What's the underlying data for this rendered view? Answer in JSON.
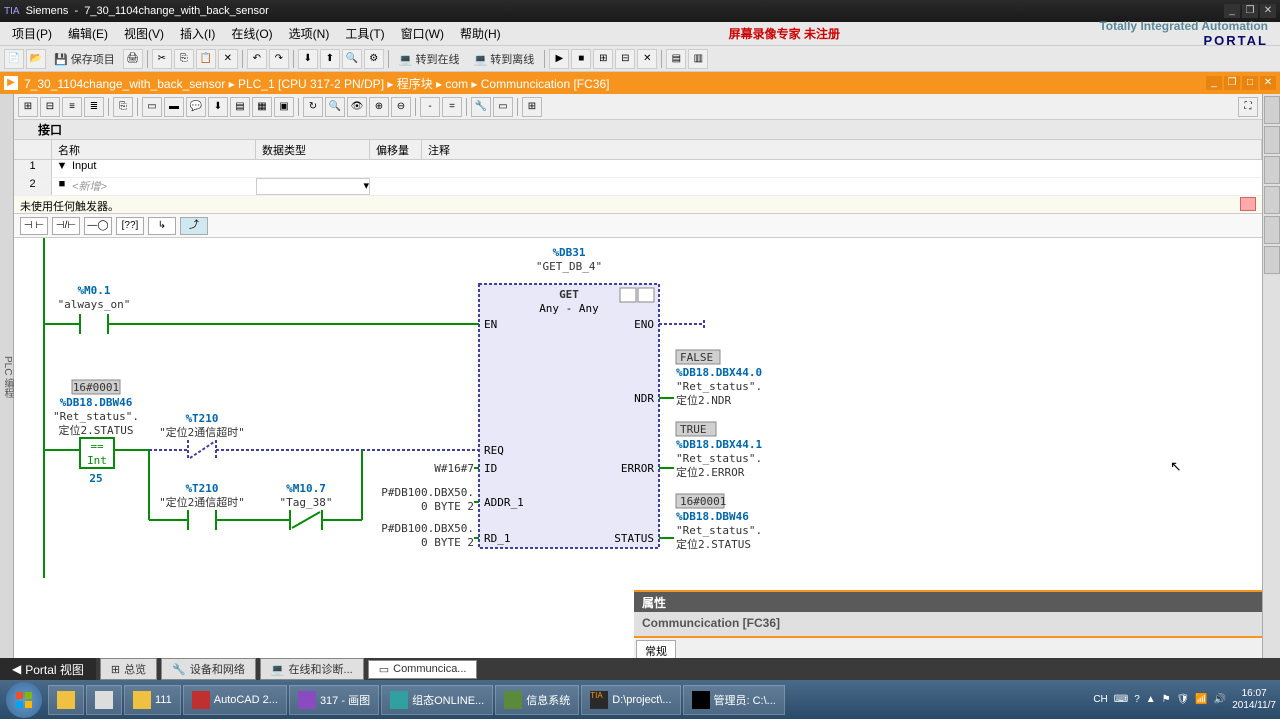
{
  "titlebar": {
    "app": "Siemens",
    "project": "7_30_1104change_with_back_sensor"
  },
  "menus": [
    "项目(P)",
    "编辑(E)",
    "视图(V)",
    "插入(I)",
    "在线(O)",
    "选项(N)",
    "工具(T)",
    "窗口(W)",
    "帮助(H)"
  ],
  "recText": "屏幕录像专家  未注册",
  "brand": {
    "top": "Totally Integrated Automation",
    "bottom": "PORTAL"
  },
  "tb1": {
    "save": "保存项目",
    "goOnline": "转到在线",
    "goOffline": "转到离线"
  },
  "breadcrumb": "7_30_1104change_with_back_sensor  ▸  PLC_1 [CPU 317-2 PN/DP]  ▸  程序块  ▸  com  ▸  Communcication [FC36]",
  "iface": {
    "title": "接口",
    "cols": {
      "name": "名称",
      "type": "数据类型",
      "offset": "偏移量",
      "comment": "注释"
    },
    "rows": [
      {
        "n": "1",
        "icon": "▼",
        "name": "Input"
      },
      {
        "n": "2",
        "icon": "■",
        "name": "<新增>"
      }
    ]
  },
  "trigger": "未使用任何触发器。",
  "instr": [
    "⊣ ⊢",
    "⊣/⊢",
    "—◯—",
    "[??]",
    "↳",
    "⤴"
  ],
  "lad": {
    "db": {
      "addr": "%DB31",
      "name": "\"GET_DB_4\""
    },
    "block": {
      "title": "GET",
      "type": "Any  -  Any"
    },
    "always": {
      "addr": "%M0.1",
      "name": "\"always_on\""
    },
    "st1": {
      "val": "16#0001",
      "addr": "%DB18.DBW46",
      "name": "\"Ret_status\".",
      "sub": "定位2.STATUS",
      "cmp": "==",
      "t": "Int",
      "v": "25"
    },
    "t1": {
      "addr": "%T210",
      "name": "\"定位2通信超时\""
    },
    "t2": {
      "addr": "%T210",
      "name": "\"定位2通信超时\""
    },
    "m107": {
      "addr": "%M10.7",
      "name": "\"Tag_38\""
    },
    "id": "W#16#7",
    "addr1": {
      "l1": "P#DB100.DBX50.",
      "l2": "0 BYTE 2"
    },
    "rd1": {
      "l1": "P#DB100.DBX50.",
      "l2": "0 BYTE 2"
    },
    "ports": {
      "en": "EN",
      "eno": "ENO",
      "req": "REQ",
      "id": "ID",
      "addr1": "ADDR_1",
      "rd1": "RD_1",
      "ndr": "NDR",
      "err": "ERROR",
      "status": "STATUS"
    },
    "ndr": {
      "val": "FALSE",
      "addr": "%DB18.DBX44.0",
      "name": "\"Ret_status\".",
      "sub": "定位2.NDR"
    },
    "err": {
      "val": "TRUE",
      "addr": "%DB18.DBX44.1",
      "name": "\"Ret_status\".",
      "sub": "定位2.ERROR"
    },
    "status": {
      "val": "16#0001",
      "addr": "%DB18.DBW46",
      "name": "\"Ret_status\".",
      "sub": "定位2.STATUS"
    }
  },
  "props": {
    "title": "属性",
    "sub": "Communcication [FC36]",
    "tab": "常规"
  },
  "bottom": {
    "portal": "Portal 视图",
    "tabs": [
      "总览",
      "设备和网络",
      "在线和诊断...",
      "Communcica..."
    ]
  },
  "task": [
    {
      "label": "111"
    },
    {
      "label": "AutoCAD 2..."
    },
    {
      "label": "317 - 画图"
    },
    {
      "label": "组态ONLINE..."
    },
    {
      "label": "信息系统"
    },
    {
      "label": "D:\\project\\..."
    },
    {
      "label": "管理员: C:\\..."
    }
  ],
  "tray": {
    "ime": "CH",
    "time": "16:07",
    "date": "2014/11/7"
  }
}
